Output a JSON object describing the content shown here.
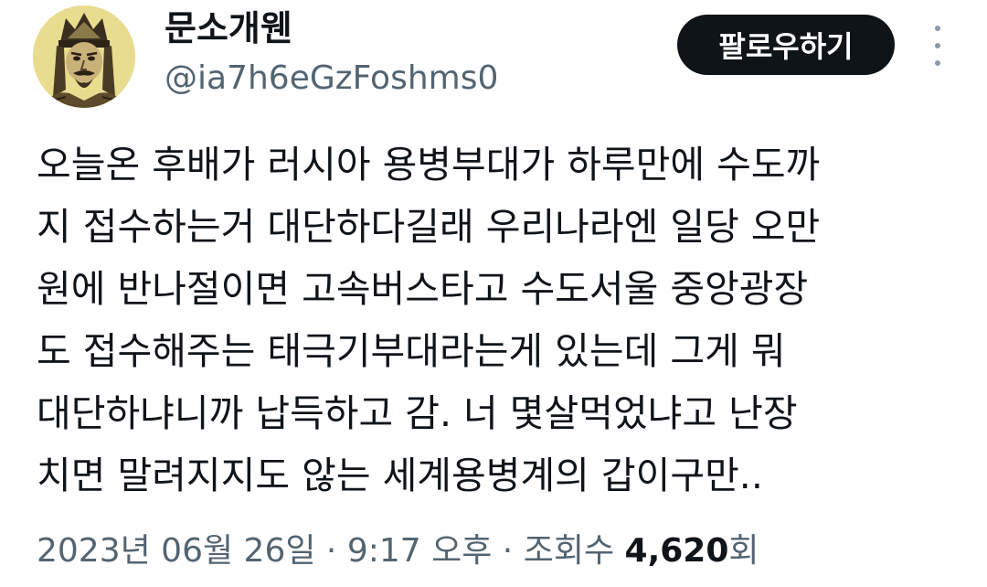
{
  "user": {
    "display_name": "문소개웬",
    "handle": "@ia7h6eGzFoshms0",
    "avatar_icon": "warrior-portrait-avatar"
  },
  "actions": {
    "follow_label": "팔로우하기",
    "more_icon": "more-vertical-icon"
  },
  "tweet": {
    "lines": [
      "오늘온 후배가 러시아 용병부대가 하루만에 수도까",
      "지 접수하는거 대단하다길래 우리나라엔 일당 오만",
      "원에 반나절이면 고속버스타고 수도서울 중앙광장",
      "도 접수해주는 태극기부대라는게 있는데 그게 뭐",
      "대단하냐니까 납득하고 감. 너 몇살먹었냐고 난장",
      "치면 말려지지도 않는 세계용병계의 갑이구만.."
    ]
  },
  "meta": {
    "date": "2023년 06월 26일",
    "sep1": " · ",
    "time": "9:17 오후",
    "sep2": " · ",
    "views_label": "조회수 ",
    "views_count": "4,620",
    "views_suffix": "회"
  },
  "colors": {
    "text_primary": "#0f1419",
    "text_secondary": "#536471",
    "button_bg": "#0f1419",
    "avatar_bg": "#e6d98a"
  }
}
